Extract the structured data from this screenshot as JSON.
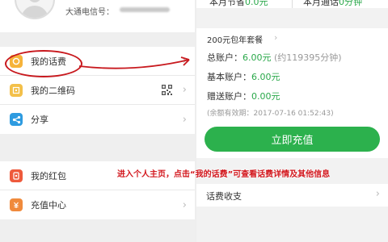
{
  "profile": {
    "phone_label": "大通电信号："
  },
  "menu_group_1": {
    "my_bill": "我的话费",
    "my_qr": "我的二维码",
    "share": "分享"
  },
  "menu_group_2": {
    "red_packet": "我的红包",
    "recharge_center": "充值中心"
  },
  "top_stats": {
    "left_label": "本月节省",
    "left_value": "0.0元",
    "right_label": "本月通话",
    "right_value": "0分钟"
  },
  "account": {
    "plan_name": "200元包年套餐",
    "total_label": "总账户：",
    "total_value": "6.00元",
    "total_note": "(约119395分钟)",
    "basic_label": "基本账户：",
    "basic_value": "6.00元",
    "gift_label": "赠送账户：",
    "gift_value": "0.00元",
    "expiry": "(余额有效期：2017-07-16 01:52:43)",
    "recharge_button": "立即充值"
  },
  "bill_row": {
    "label": "话费收支"
  },
  "annotation": {
    "caption": "进入个人主页，点击“我的话费”可查看话费详情及其他信息"
  },
  "colors": {
    "accent_green": "#2cb14d",
    "annotation_red": "#c8191e"
  },
  "icons": {
    "bill": "coin-icon",
    "qr": "qr-code-icon",
    "share": "share-icon",
    "red_packet": "red-packet-icon",
    "recharge": "recharge-icon",
    "chevron": "chevron-right-icon"
  }
}
